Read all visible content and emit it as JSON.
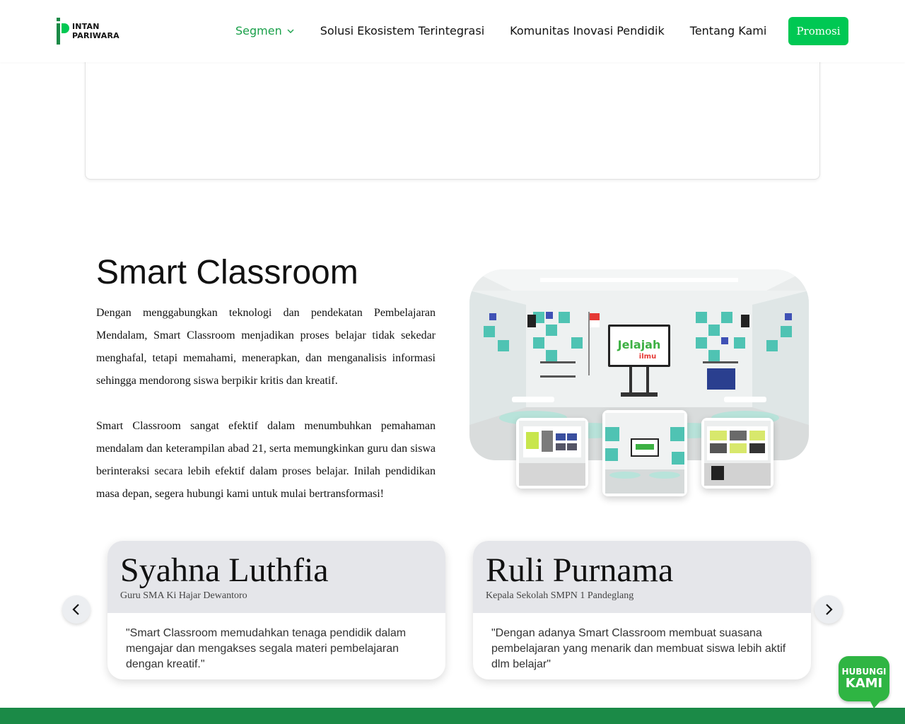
{
  "header": {
    "logo_line1": "INTAN",
    "logo_line2": "PARIWARA",
    "nav": {
      "segmen": "Segmen",
      "solusi": "Solusi Ekosistem Terintegrasi",
      "komunitas": "Komunitas Inovasi Pendidik",
      "tentang": "Tentang Kami"
    },
    "promo_label": "Promosi"
  },
  "smart_classroom": {
    "title": "Smart Classroom",
    "paragraph1": "Dengan menggabungkan teknologi dan pendekatan Pembelajaran Mendalam, Smart Classroom menjadikan proses belajar tidak sekedar menghafal, tetapi memahami, menerapkan, dan menganalisis informasi sehingga mendorong siswa berpikir kritis dan kreatif.",
    "paragraph2": "Smart Classroom sangat efektif dalam menumbuhkan pemahaman mendalam dan keterampilan abad 21, serta memungkinkan guru dan siswa berinteraksi secara lebih efektif dalam proses belajar. Inilah pendidikan masa depan, segera hubungi kami untuk mulai bertransformasi!",
    "screen_text_1": "Jelajah",
    "screen_text_2": "ilmu"
  },
  "testimonials": [
    {
      "name": "Syahna Luthfia",
      "role": "Guru SMA Ki Hajar Dewantoro",
      "quote": "\"Smart Classroom memudahkan tenaga pendidik dalam mengajar dan mengakses segala materi pembelajaran dengan kreatif.\""
    },
    {
      "name": "Ruli Purnama",
      "role": "Kepala Sekolah SMPN 1 Pandeglang",
      "quote": "\"Dengan adanya Smart Classroom membuat suasana pembelajaran yang menarik dan membuat siswa lebih aktif dlm belajar\""
    }
  ],
  "contact": {
    "line1": "HUBUNGI",
    "line2": "KAMI"
  },
  "colors": {
    "brand_green": "#00c853",
    "nav_active": "#1aa04a",
    "footer": "#1b8a47"
  }
}
